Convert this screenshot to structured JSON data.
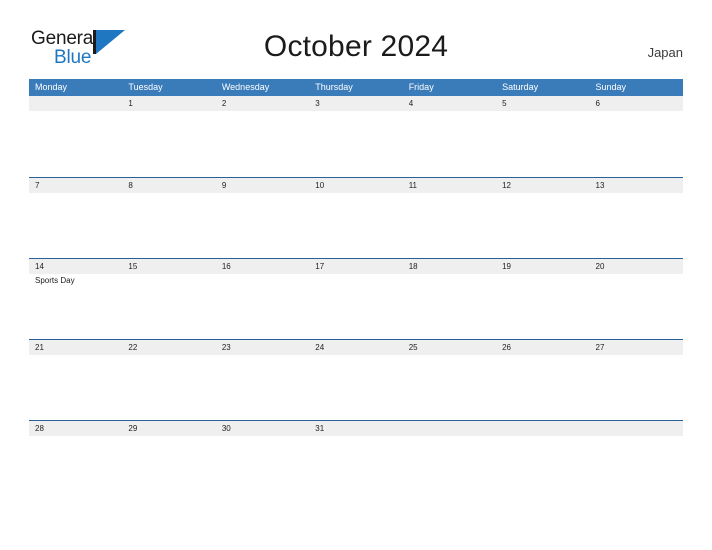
{
  "brand": {
    "name_part1": "General",
    "name_part2": "Blue",
    "logo_icon": "blue-triangle-mark"
  },
  "header": {
    "title": "October 2024",
    "locale": "Japan"
  },
  "calendar": {
    "month": "October",
    "year": "2024",
    "day_headers": [
      "Monday",
      "Tuesday",
      "Wednesday",
      "Thursday",
      "Friday",
      "Saturday",
      "Sunday"
    ],
    "weeks": [
      [
        {
          "date": "",
          "events": []
        },
        {
          "date": "1",
          "events": []
        },
        {
          "date": "2",
          "events": []
        },
        {
          "date": "3",
          "events": []
        },
        {
          "date": "4",
          "events": []
        },
        {
          "date": "5",
          "events": []
        },
        {
          "date": "6",
          "events": []
        }
      ],
      [
        {
          "date": "7",
          "events": []
        },
        {
          "date": "8",
          "events": []
        },
        {
          "date": "9",
          "events": []
        },
        {
          "date": "10",
          "events": []
        },
        {
          "date": "11",
          "events": []
        },
        {
          "date": "12",
          "events": []
        },
        {
          "date": "13",
          "events": []
        }
      ],
      [
        {
          "date": "14",
          "events": [
            "Sports Day"
          ]
        },
        {
          "date": "15",
          "events": []
        },
        {
          "date": "16",
          "events": []
        },
        {
          "date": "17",
          "events": []
        },
        {
          "date": "18",
          "events": []
        },
        {
          "date": "19",
          "events": []
        },
        {
          "date": "20",
          "events": []
        }
      ],
      [
        {
          "date": "21",
          "events": []
        },
        {
          "date": "22",
          "events": []
        },
        {
          "date": "23",
          "events": []
        },
        {
          "date": "24",
          "events": []
        },
        {
          "date": "25",
          "events": []
        },
        {
          "date": "26",
          "events": []
        },
        {
          "date": "27",
          "events": []
        }
      ],
      [
        {
          "date": "28",
          "events": []
        },
        {
          "date": "29",
          "events": []
        },
        {
          "date": "30",
          "events": []
        },
        {
          "date": "31",
          "events": []
        },
        {
          "date": "",
          "events": []
        },
        {
          "date": "",
          "events": []
        },
        {
          "date": "",
          "events": []
        }
      ]
    ]
  },
  "colors": {
    "header_blue": "#3a7cba",
    "row_rule_blue": "#2a6099",
    "band_gray": "#efefef",
    "brand_blue": "#1f77c2",
    "text_dark": "#1b1b1b"
  }
}
